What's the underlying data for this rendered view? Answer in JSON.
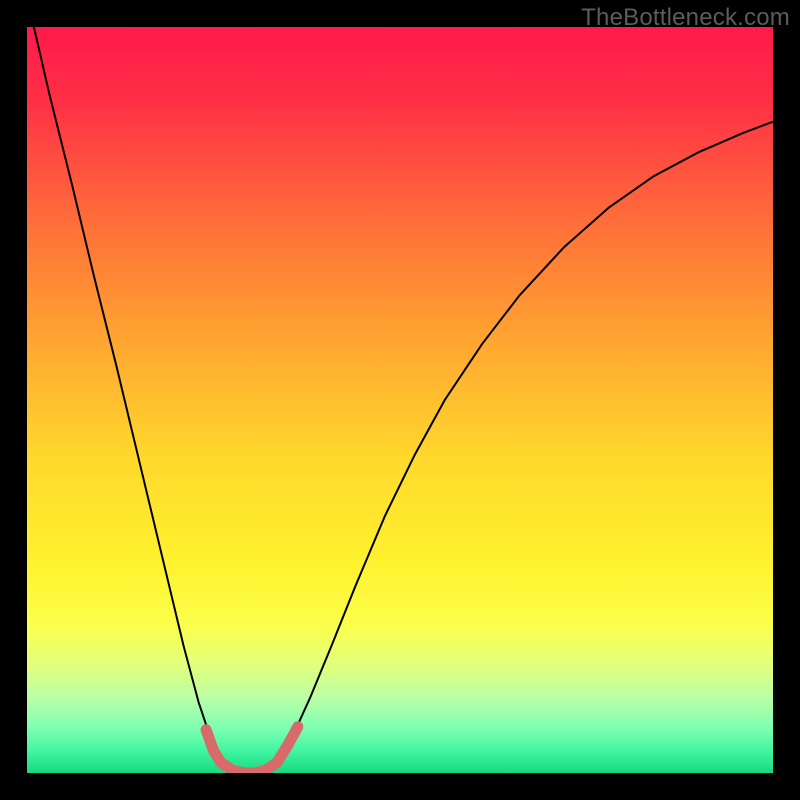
{
  "watermark": "TheBottleneck.com",
  "chart_data": {
    "type": "line",
    "title": "",
    "xlabel": "",
    "ylabel": "",
    "xlim": [
      0,
      1
    ],
    "ylim": [
      0,
      1
    ],
    "background_gradient": {
      "stops": [
        {
          "offset": 0.0,
          "color": "#ff1a4b"
        },
        {
          "offset": 0.1,
          "color": "#ff2f45"
        },
        {
          "offset": 0.25,
          "color": "#ff6a3a"
        },
        {
          "offset": 0.42,
          "color": "#ffa531"
        },
        {
          "offset": 0.58,
          "color": "#ffd92c"
        },
        {
          "offset": 0.72,
          "color": "#fff22e"
        },
        {
          "offset": 0.8,
          "color": "#fbff4a"
        },
        {
          "offset": 0.85,
          "color": "#e6ff77"
        },
        {
          "offset": 0.9,
          "color": "#b8ffA6"
        },
        {
          "offset": 0.94,
          "color": "#7dffb3"
        },
        {
          "offset": 0.97,
          "color": "#42f5a1"
        },
        {
          "offset": 1.0,
          "color": "#17d981"
        }
      ]
    },
    "series": [
      {
        "name": "bottleneck-curve",
        "stroke": "#000000",
        "stroke_width": 2,
        "x": [
          0.0,
          0.03,
          0.06,
          0.09,
          0.12,
          0.15,
          0.18,
          0.21,
          0.23,
          0.25,
          0.265,
          0.28,
          0.29,
          0.3,
          0.31,
          0.32,
          0.335,
          0.355,
          0.38,
          0.41,
          0.44,
          0.48,
          0.52,
          0.56,
          0.61,
          0.66,
          0.72,
          0.78,
          0.84,
          0.9,
          0.96,
          1.0
        ],
        "y": [
          1.04,
          0.91,
          0.79,
          0.665,
          0.545,
          0.42,
          0.295,
          0.17,
          0.095,
          0.035,
          0.015,
          0.004,
          0.0,
          0.0,
          0.0,
          0.004,
          0.014,
          0.047,
          0.102,
          0.175,
          0.25,
          0.345,
          0.427,
          0.5,
          0.575,
          0.64,
          0.705,
          0.758,
          0.8,
          0.832,
          0.858,
          0.873
        ]
      },
      {
        "name": "good-range-band",
        "stroke": "#d86a6a",
        "stroke_width": 11,
        "linecap": "round",
        "x": [
          0.24,
          0.25,
          0.26,
          0.275,
          0.29,
          0.305,
          0.32,
          0.335,
          0.35,
          0.363
        ],
        "y": [
          0.058,
          0.03,
          0.014,
          0.004,
          0.0,
          0.0,
          0.004,
          0.014,
          0.038,
          0.062
        ]
      }
    ]
  }
}
